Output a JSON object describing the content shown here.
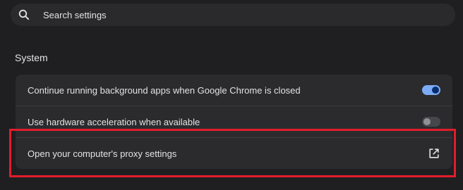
{
  "search": {
    "placeholder": "Search settings",
    "icon": "search-icon"
  },
  "section": {
    "title": "System"
  },
  "settings": [
    {
      "label": "Continue running background apps when Google Chrome is closed",
      "control": "toggle",
      "enabled": true
    },
    {
      "label": "Use hardware acceleration when available",
      "control": "toggle",
      "enabled": false
    },
    {
      "label": "Open your computer's proxy settings",
      "control": "external-link",
      "icon": "open-in-new-icon"
    }
  ],
  "colors": {
    "background": "#1f1f21",
    "card": "#2b2b2e",
    "toggle_on": "#7cacf8",
    "toggle_off": "#46474a",
    "highlight": "#e21d2b"
  }
}
